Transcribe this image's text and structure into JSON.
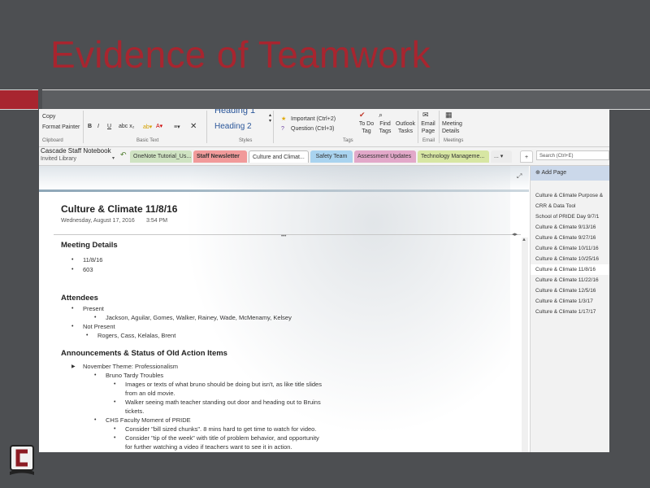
{
  "slide": {
    "title": "Evidence of Teamwork"
  },
  "ribbon": {
    "clipboard": {
      "copy": "Copy",
      "format_painter": "Format Painter",
      "group": "Clipboard"
    },
    "basic_text": {
      "group": "Basic Text",
      "bold": "B",
      "italic": "I",
      "underline": "U"
    },
    "styles": {
      "heading1": "Heading 1",
      "heading2": "Heading 2",
      "group": "Styles"
    },
    "tags": {
      "important": "Important (Ctrl+2)",
      "question": "Question (Ctrl+3)",
      "todo": "To Do Tag",
      "find": "Find Tags",
      "outlook": "Outlook Tasks",
      "group": "Tags"
    },
    "email": {
      "label": "Email Page",
      "group": "Email"
    },
    "meetings": {
      "label": "Meeting Details",
      "group": "Meetings"
    }
  },
  "notebook": {
    "name": "Cascade Staff Notebook",
    "sub": "Invited Library"
  },
  "tabs": [
    {
      "label": "OneNote Tutorial_Us...",
      "color": "#cfe3c2"
    },
    {
      "label": "Staff Newsletter",
      "color": "#f19a9a"
    },
    {
      "label": "Culture and Climat...",
      "color": "#ffffff"
    },
    {
      "label": "Safety Team",
      "color": "#a9d3ef"
    },
    {
      "label": "Assessment Updates",
      "color": "#e2a8c9"
    },
    {
      "label": "Technology Manageme...",
      "color": "#d7e6a3"
    }
  ],
  "search": {
    "placeholder": "Search (Ctrl+E)"
  },
  "page": {
    "title": "Culture & Climate 11/8/16",
    "date": "Wednesday, August 17, 2016",
    "time": "3:54 PM",
    "meeting_details": {
      "heading": "Meeting Details",
      "items": [
        "11/8/16",
        "603"
      ]
    },
    "attendees": {
      "heading": "Attendees",
      "present_label": "Present",
      "present": "Jackson, Aguilar, Gomes, Walker, Rainey, Wade, McMenamy, Kelsey",
      "not_present_label": "Not Present",
      "not_present": "Rogers, Cass, Kelalas, Brent"
    },
    "announcements": {
      "heading": "Announcements & Status of Old Action Items",
      "l1": "November Theme: Professionalism",
      "l2": "Bruno Tardy Troubles",
      "l3a": "Images or texts of what bruno should be doing but isn't, as like title slides",
      "l3a2": "from an old movie.",
      "l3b": "Walker seeing math teacher standing out door and heading out to Bruins",
      "l3b2": "tickets.",
      "l4": "CHS Faculty Moment of PRIDE",
      "l5a": "Consider \"bill sized chunks\". 8 mins hard to get time to watch for video.",
      "l5b": "Consider \"tip of the week\" with title of problem behavior, and opportunity",
      "l5b2": "for further watching a video if teachers want to see it in action."
    }
  },
  "sidebar": {
    "add_page": "Add Page",
    "pages": [
      "Culture & Climate Purpose &",
      "CRR & Data Tool",
      "School of PRIDE Day 9/7/1",
      "Culture & Climate 9/13/16",
      "Culture & Climate 9/27/16",
      "Culture & Climate 10/11/16",
      "Culture & Climate 10/25/16",
      "Culture & Climate 11/8/16",
      "Culture & Climate 11/22/16",
      "Culture & Climate 12/5/16",
      "Culture & Climate 1/3/17",
      "Culture & Climate 1/17/17"
    ],
    "selected_index": 7
  }
}
